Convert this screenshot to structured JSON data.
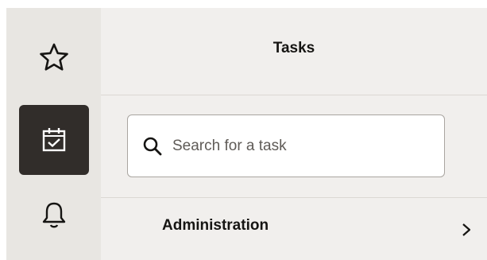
{
  "rail": {
    "items": [
      {
        "name": "favorites",
        "icon": "star-icon",
        "selected": false
      },
      {
        "name": "tasks",
        "icon": "calendar-check-icon",
        "selected": true
      },
      {
        "name": "notifications",
        "icon": "bell-icon",
        "selected": false
      }
    ]
  },
  "panel": {
    "title": "Tasks",
    "search": {
      "placeholder": "Search for a task",
      "value": ""
    },
    "items": [
      {
        "label": "Administration"
      }
    ]
  },
  "colors": {
    "rail_bg": "#e8e6e2",
    "panel_bg": "#f1efed",
    "selected_bg": "#312d2a",
    "text": "#161513"
  }
}
